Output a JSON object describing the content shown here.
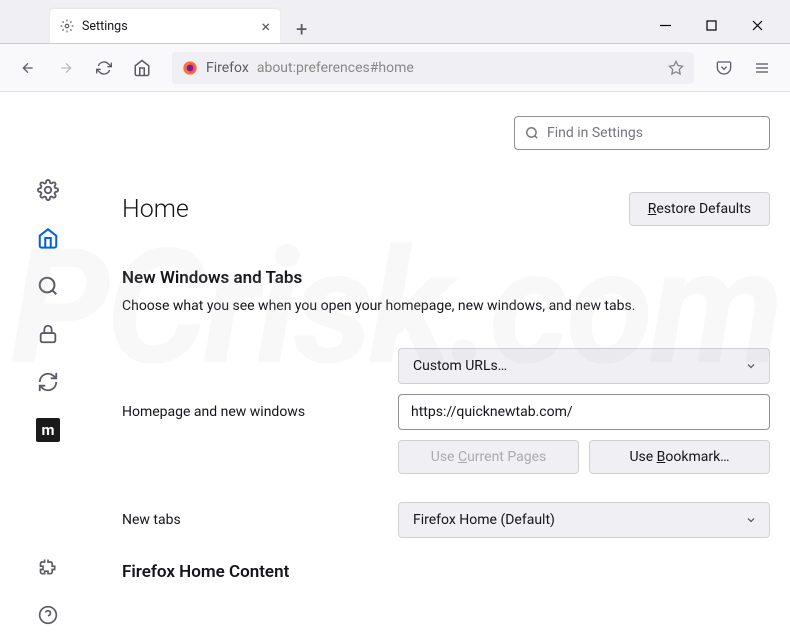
{
  "tab": {
    "title": "Settings"
  },
  "addressBar": {
    "prefix": "Firefox",
    "url": "about:preferences#home"
  },
  "search": {
    "placeholder": "Find in Settings"
  },
  "page": {
    "title": "Home",
    "restoreBtn": "Restore Defaults"
  },
  "section1": {
    "title": "New Windows and Tabs",
    "desc": "Choose what you see when you open your homepage, new windows, and new tabs."
  },
  "homepage": {
    "label": "Homepage and new windows",
    "selectValue": "Custom URLs…",
    "urlValue": "https://quicknewtab.com/",
    "useCurrentBtn": "Use Current Pages",
    "useBookmarkBtn": "Use Bookmark…"
  },
  "newtabs": {
    "label": "New tabs",
    "selectValue": "Firefox Home (Default)"
  },
  "section2": {
    "title": "Firefox Home Content"
  }
}
